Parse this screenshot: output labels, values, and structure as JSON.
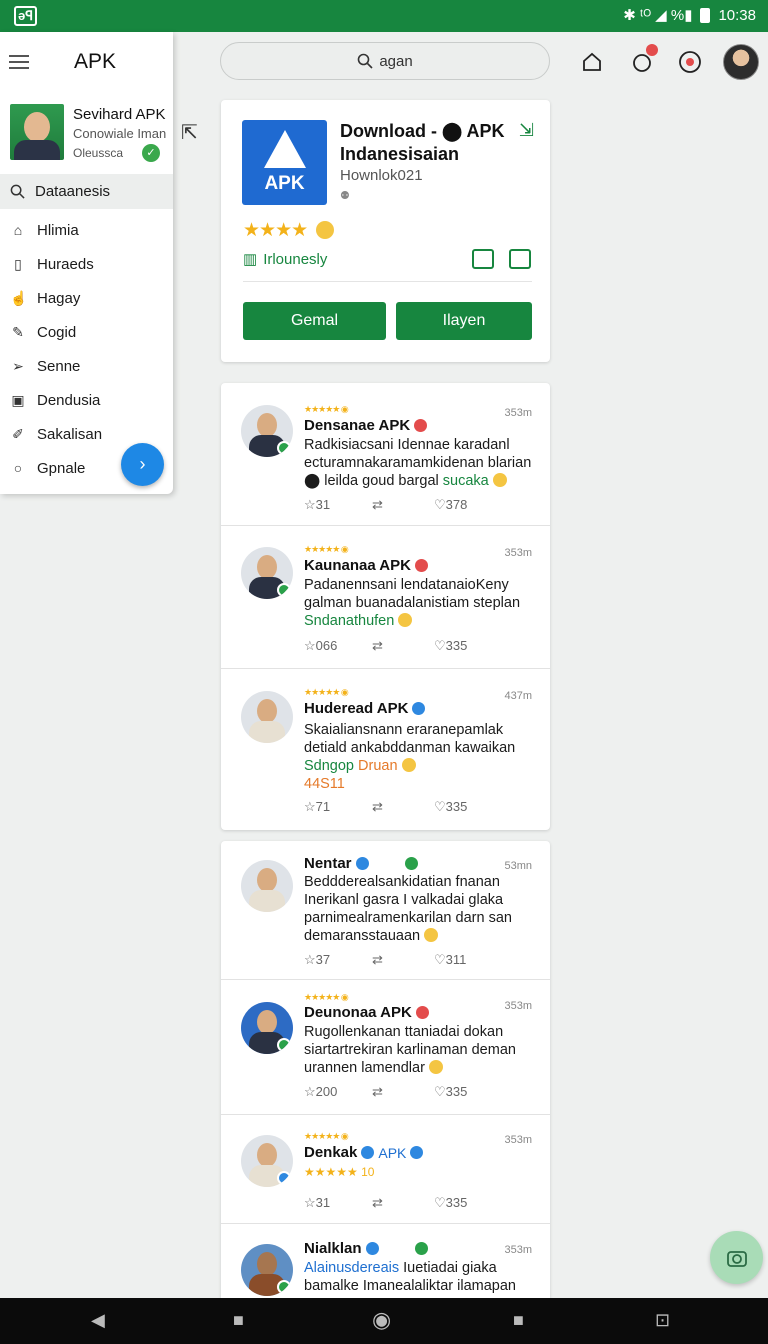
{
  "status_bar": {
    "logo": "ǝꟼ",
    "icons": "✱ ᵗᴼ ◢ %▮",
    "time": "10:38"
  },
  "top_bar": {
    "search_query": "agan"
  },
  "drawer": {
    "title": "APK",
    "profile": {
      "name": "Sevihard APK",
      "subtitle": "Conowiale Iman",
      "status": "Oleussca"
    },
    "search_item": "Dataanesis",
    "items": [
      {
        "label": "Hlimia",
        "icon": "home-icon"
      },
      {
        "label": "Huraeds",
        "icon": "bookmark-icon"
      },
      {
        "label": "Hagay",
        "icon": "thumb-icon"
      },
      {
        "label": "Cogid",
        "icon": "pen-icon"
      },
      {
        "label": "Senne",
        "icon": "send-icon"
      },
      {
        "label": "Dendusia",
        "icon": "lock-icon"
      },
      {
        "label": "Sakalisan",
        "icon": "edit-icon"
      },
      {
        "label": "Gpnale",
        "icon": "circle-icon"
      }
    ]
  },
  "app_card": {
    "title_line1": "Download - ⬤ APK",
    "title_line2": "Indanesisaian",
    "subtitle": "Hownlok021",
    "developer": "Irlounesly",
    "rating_stars": 4,
    "button_left": "Gemal",
    "button_right": "Ilayen",
    "accent": "#17863f",
    "icon_label": "APK"
  },
  "feed1": [
    {
      "name": "Densanae APK",
      "time": "353m",
      "line1": "Radkisiacsani Idennae karadanl",
      "line2": "ecturamnakaramamkidenan blarian",
      "line3_pre": "⬤ leilda goud bargal ",
      "line3_hl": "sucaka",
      "likes_a": "31",
      "likes_c": "378"
    },
    {
      "name": "Kaunanaa APK",
      "time": "353m",
      "line1": "Padanennsani lendatanaioKeny",
      "line2": "galman buanadalanistiam steplan",
      "line3_hl": "Sndanathufen",
      "likes_a": "066",
      "likes_c": "335"
    },
    {
      "name": "Huderead APK",
      "time": "437m",
      "line1": "Skaialiansnann eraranepamlak",
      "line2": "detiald ankabddanman kawaikan",
      "line3_hl": "Sdngop",
      "line3_post": "Druan",
      "line4_or": "44S11",
      "likes_a": "71",
      "likes_c": "335"
    }
  ],
  "feed2": [
    {
      "name": "Nentar",
      "time": "53mn",
      "line1": "Beddderealsankidatian fnanan",
      "line2": "Inerikanl gasra I valkadai glaka",
      "line3": "parnimealramenkarilan darn san",
      "line4": "demaransstauaan",
      "likes_a": "37",
      "likes_c": "311"
    },
    {
      "name": "Deunonaa APK",
      "time": "353m",
      "line1": "Rugollenkanan ttaniadai dokan",
      "line2": "siartartrekiran karlinaman deman",
      "line3": "urannen lamendlar",
      "likes_a": "200",
      "likes_c": "335"
    },
    {
      "name": "Denkak",
      "name_extra": "APK",
      "time": "353m",
      "rating": "★★★★★ 10",
      "likes_a": "31",
      "likes_c": "335"
    },
    {
      "name": "Nialklan",
      "time": "353m",
      "line1_bl": "Alainusdereais",
      "line1": " Iuetiadai giaka",
      "line2": "bamalke Imanealaliktar ilamapan"
    }
  ],
  "nav": {
    "back": "◀",
    "home": "◉",
    "recent": "■"
  }
}
